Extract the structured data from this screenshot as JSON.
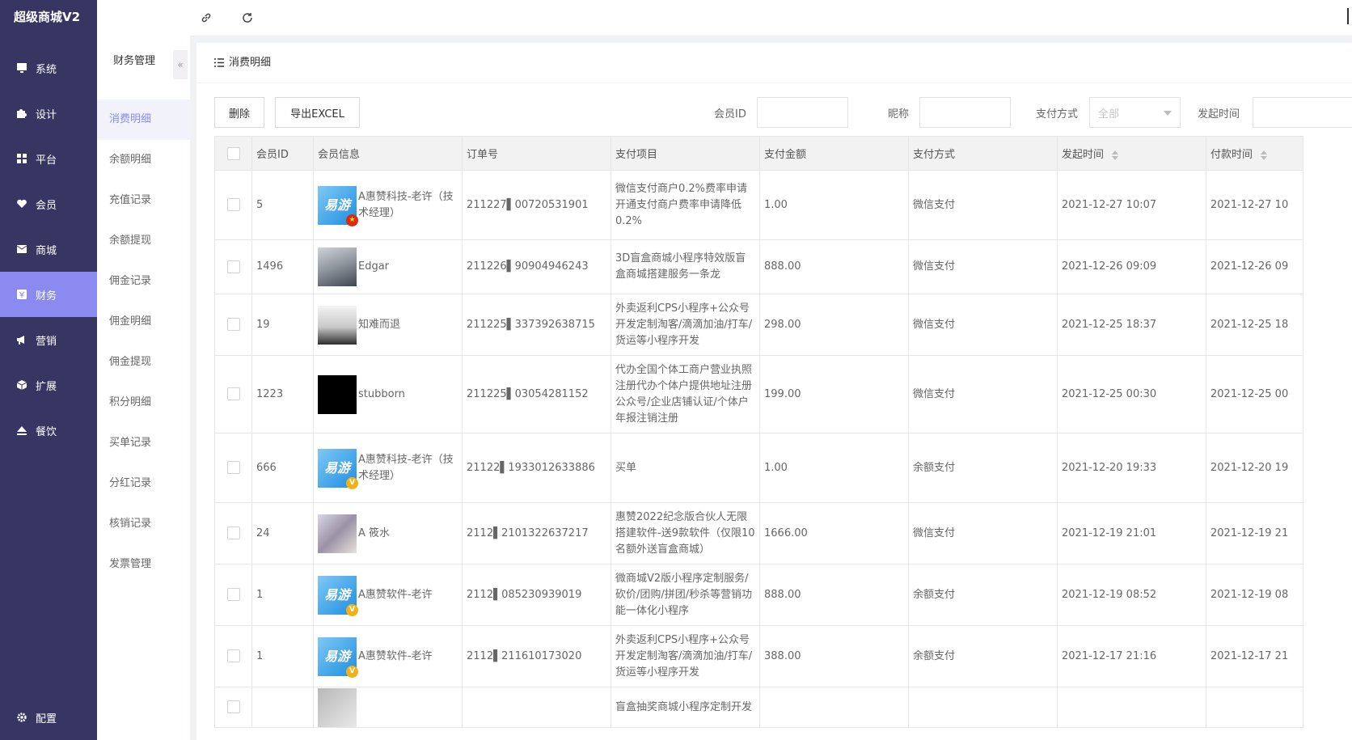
{
  "app": {
    "title": "超级商城V2"
  },
  "nav": {
    "items": [
      {
        "label": "系统",
        "icon": "monitor-icon"
      },
      {
        "label": "设计",
        "icon": "puzzle-icon"
      },
      {
        "label": "平台",
        "icon": "grid-icon"
      },
      {
        "label": "会员",
        "icon": "heart-icon"
      },
      {
        "label": "商城",
        "icon": "mail-icon"
      },
      {
        "label": "财务",
        "icon": "finance-icon"
      },
      {
        "label": "营销",
        "icon": "megaphone-icon"
      },
      {
        "label": "扩展",
        "icon": "cube-icon"
      },
      {
        "label": "餐饮",
        "icon": "eject-icon"
      }
    ],
    "active_index": 5,
    "bottom": {
      "label": "配置",
      "icon": "gear-icon"
    },
    "colors": {
      "bg": "#373663",
      "active": "#8a8af0"
    }
  },
  "subnav": {
    "title": "财务管理",
    "collapse_icon": "double-chevron-left-icon",
    "items": [
      "消费明细",
      "余额明细",
      "充值记录",
      "余额提现",
      "佣金记录",
      "佣金明细",
      "佣金提现",
      "积分明细",
      "买单记录",
      "分红记录",
      "核销记录",
      "发票管理"
    ],
    "active_index": 0
  },
  "topbar": {
    "icons": [
      "menu-fold-icon",
      "fullscreen-icon",
      "link-icon",
      "refresh-icon"
    ]
  },
  "page": {
    "title": "消费明细"
  },
  "toolbar": {
    "delete_label": "删除",
    "export_label": "导出EXCEL",
    "filters": {
      "member_id_label": "会员ID",
      "nickname_label": "昵称",
      "pay_method_label": "支付方式",
      "pay_method_value": "全部",
      "start_time_label": "发起时间"
    }
  },
  "table": {
    "headers": [
      "会员ID",
      "会员信息",
      "订单号",
      "支付项目",
      "支付金额",
      "支付方式",
      "发起时间",
      "付款时间"
    ],
    "rows": [
      {
        "id": "5",
        "avatar": "brand",
        "badge": "cn",
        "name": "A惠赞科技-老许（技术经理）",
        "order": "211227▌00720531901",
        "item": "微信支付商户0.2%费率申请开通支付商户费率申请降低0.2%",
        "amount": "1.00",
        "method": "微信支付",
        "start": "2021-12-27 10:07",
        "paid": "2021-12-27 10"
      },
      {
        "id": "1496",
        "avatar": "photo1",
        "badge": "",
        "name": "Edgar",
        "order": "211226▌90904946243",
        "item": "3D盲盒商城小程序特效版盲盒商城搭建服务一条龙",
        "amount": "888.00",
        "method": "微信支付",
        "start": "2021-12-26 09:09",
        "paid": "2021-12-26 09"
      },
      {
        "id": "19",
        "avatar": "photo2",
        "badge": "",
        "name": "知难而退",
        "order": "211225▌337392638715",
        "item": "外卖返利CPS小程序+公众号开发定制淘客/滴滴加油/打车/货运等小程序开发",
        "amount": "298.00",
        "method": "微信支付",
        "start": "2021-12-25 18:37",
        "paid": "2021-12-25 18"
      },
      {
        "id": "1223",
        "avatar": "black",
        "badge": "",
        "name": "stubborn",
        "order": "211225▌03054281152",
        "item": "代办全国个体工商户营业执照注册代办个体户提供地址注册公众号/企业店铺认证/个体户年报注销注册",
        "amount": "199.00",
        "method": "微信支付",
        "start": "2021-12-25 00:30",
        "paid": "2021-12-25 00"
      },
      {
        "id": "666",
        "avatar": "brand",
        "badge": "v",
        "name": "A惠赞科技-老许（技术经理）",
        "order": "21122▌1933012633886",
        "item": "买单",
        "amount": "1.00",
        "method": "余额支付",
        "start": "2021-12-20 19:33",
        "paid": "2021-12-20 19"
      },
      {
        "id": "24",
        "avatar": "photo3",
        "badge": "",
        "name": "A 筱水",
        "order": "2112▌2101322637217",
        "item": "惠赞2022纪念版合伙人无限搭建软件-送9款软件（仅限10名额外送盲盒商城）",
        "amount": "1666.00",
        "method": "微信支付",
        "start": "2021-12-19 21:01",
        "paid": "2021-12-19 21"
      },
      {
        "id": "1",
        "avatar": "brand",
        "badge": "v",
        "name": "A惠赞软件-老许",
        "order": "2112▌085230939019",
        "item": "微商城V2版小程序定制服务/砍价/团购/拼团/秒杀等营销功能一体化小程序",
        "amount": "888.00",
        "method": "余额支付",
        "start": "2021-12-19 08:52",
        "paid": "2021-12-19 08"
      },
      {
        "id": "1",
        "avatar": "brand",
        "badge": "v",
        "name": "A惠赞软件-老许",
        "order": "2112▌211610173020",
        "item": "外卖返利CPS小程序+公众号开发定制淘客/滴滴加油/打车/货运等小程序开发",
        "amount": "388.00",
        "method": "余额支付",
        "start": "2021-12-17 21:16",
        "paid": "2021-12-17 21"
      },
      {
        "id": "",
        "avatar": "photo4",
        "badge": "",
        "name": "",
        "order": "",
        "item": "盲盒抽奖商城小程序定制开发",
        "amount": "",
        "method": "",
        "start": "",
        "paid": ""
      }
    ]
  },
  "brand_avatar_text": "易游"
}
